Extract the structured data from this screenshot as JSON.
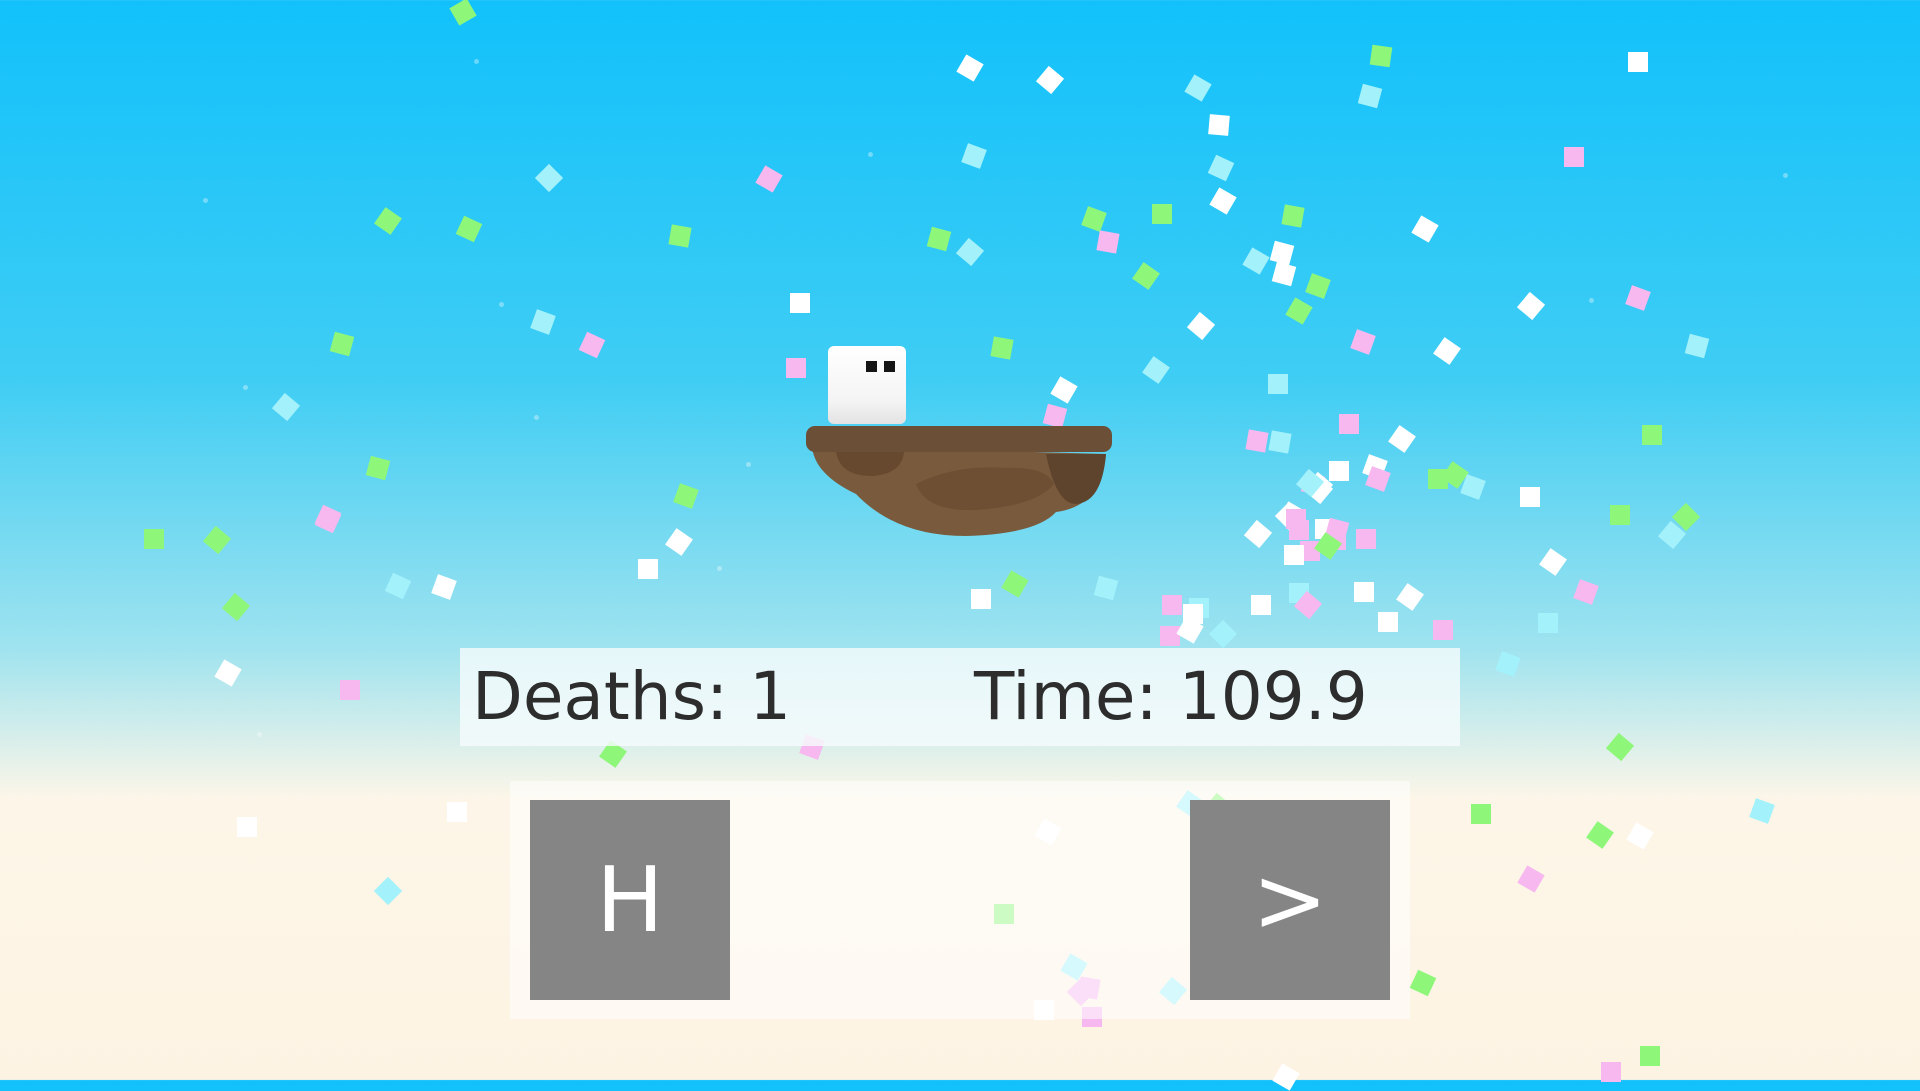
{
  "hud": {
    "deaths_text": "Deaths: 1",
    "time_text": "Time: 109.9"
  },
  "controls": {
    "home_label": "H",
    "next_label": ">"
  },
  "colors": {
    "sky_top": "#12c1fb",
    "ground_haze": "#fdf3e3",
    "button_bg": "#858585",
    "island_brown": "#7a5a3c",
    "confetti": [
      "#8ef77a",
      "#ffffff",
      "#a2f1fb",
      "#f7b7ef"
    ]
  },
  "icons": {
    "player": "white-cube-character",
    "island": "floating-dirt-island"
  }
}
